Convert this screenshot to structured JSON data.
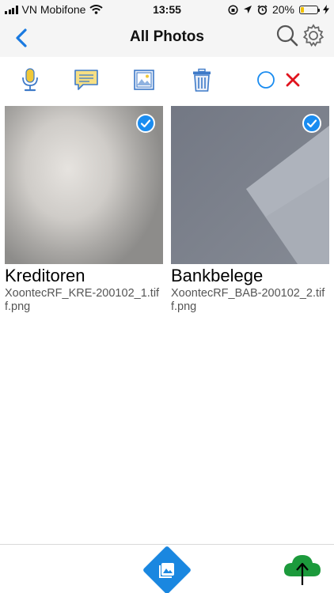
{
  "status_bar": {
    "carrier": "VN Mobifone",
    "time": "13:55",
    "battery_percent_text": "20%",
    "battery_level": 0.2
  },
  "nav": {
    "title": "All Photos",
    "icons": [
      "back-chevron-icon",
      "search-icon",
      "gear-icon"
    ]
  },
  "toolbar": {
    "icons": [
      "microphone-icon",
      "comment-icon",
      "image-icon",
      "trash-icon",
      "circle-select-icon",
      "close-icon"
    ]
  },
  "photos": [
    {
      "label": "Kreditoren",
      "filename": "XoontecRF_KRE-200102_1.tiff.png",
      "selected": true
    },
    {
      "label": "Bankbelege",
      "filename": "XoontecRF_BAB-200102_2.tiff.png",
      "selected": true
    }
  ],
  "bottom_bar": {
    "icons": [
      "gallery-icon",
      "cloud-upload-icon"
    ]
  },
  "colors": {
    "accent": "#1a8cf0",
    "toolbar_icon": "#3e7ac8",
    "mic_yellow": "#f0c838",
    "close_red": "#e0141e",
    "cloud_green": "#1c9a3c"
  }
}
